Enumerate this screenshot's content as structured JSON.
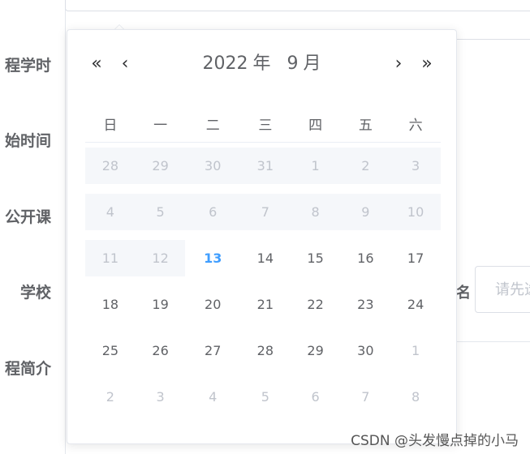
{
  "form": {
    "labels": [
      "程学时",
      "始时间",
      "公开课",
      "学校",
      "程简介"
    ],
    "school_extra": "名",
    "school_placeholder": "请先选"
  },
  "picker": {
    "prev_year_icon": "«",
    "prev_month_icon": "‹",
    "next_month_icon": "›",
    "next_year_icon": "»",
    "year": "2022",
    "year_suffix": "年",
    "month": "9",
    "month_suffix": "月",
    "weekdays": [
      "日",
      "一",
      "二",
      "三",
      "四",
      "五",
      "六"
    ],
    "weeks": [
      [
        {
          "d": "28",
          "s": "disabled"
        },
        {
          "d": "29",
          "s": "disabled"
        },
        {
          "d": "30",
          "s": "disabled"
        },
        {
          "d": "31",
          "s": "disabled"
        },
        {
          "d": "1",
          "s": "disabled"
        },
        {
          "d": "2",
          "s": "disabled"
        },
        {
          "d": "3",
          "s": "disabled"
        }
      ],
      [
        {
          "d": "4",
          "s": "disabled"
        },
        {
          "d": "5",
          "s": "disabled"
        },
        {
          "d": "6",
          "s": "disabled"
        },
        {
          "d": "7",
          "s": "disabled"
        },
        {
          "d": "8",
          "s": "disabled"
        },
        {
          "d": "9",
          "s": "disabled"
        },
        {
          "d": "10",
          "s": "disabled"
        }
      ],
      [
        {
          "d": "11",
          "s": "disabled"
        },
        {
          "d": "12",
          "s": "disabled"
        },
        {
          "d": "13",
          "s": "today"
        },
        {
          "d": "14",
          "s": "available"
        },
        {
          "d": "15",
          "s": "available"
        },
        {
          "d": "16",
          "s": "available"
        },
        {
          "d": "17",
          "s": "available"
        }
      ],
      [
        {
          "d": "18",
          "s": "available"
        },
        {
          "d": "19",
          "s": "available"
        },
        {
          "d": "20",
          "s": "available"
        },
        {
          "d": "21",
          "s": "available"
        },
        {
          "d": "22",
          "s": "available"
        },
        {
          "d": "23",
          "s": "available"
        },
        {
          "d": "24",
          "s": "available"
        }
      ],
      [
        {
          "d": "25",
          "s": "available"
        },
        {
          "d": "26",
          "s": "available"
        },
        {
          "d": "27",
          "s": "available"
        },
        {
          "d": "28",
          "s": "available"
        },
        {
          "d": "29",
          "s": "available"
        },
        {
          "d": "30",
          "s": "available"
        },
        {
          "d": "1",
          "s": "other"
        }
      ],
      [
        {
          "d": "2",
          "s": "other"
        },
        {
          "d": "3",
          "s": "other"
        },
        {
          "d": "4",
          "s": "other"
        },
        {
          "d": "5",
          "s": "other"
        },
        {
          "d": "6",
          "s": "other"
        },
        {
          "d": "7",
          "s": "other"
        },
        {
          "d": "8",
          "s": "other"
        }
      ]
    ]
  },
  "watermark": "CSDN @头发慢点掉的小马",
  "colors": {
    "today": "#409eff",
    "disabled_bg": "#f5f7fa",
    "muted_text": "#c0c4cc",
    "text": "#606266"
  }
}
